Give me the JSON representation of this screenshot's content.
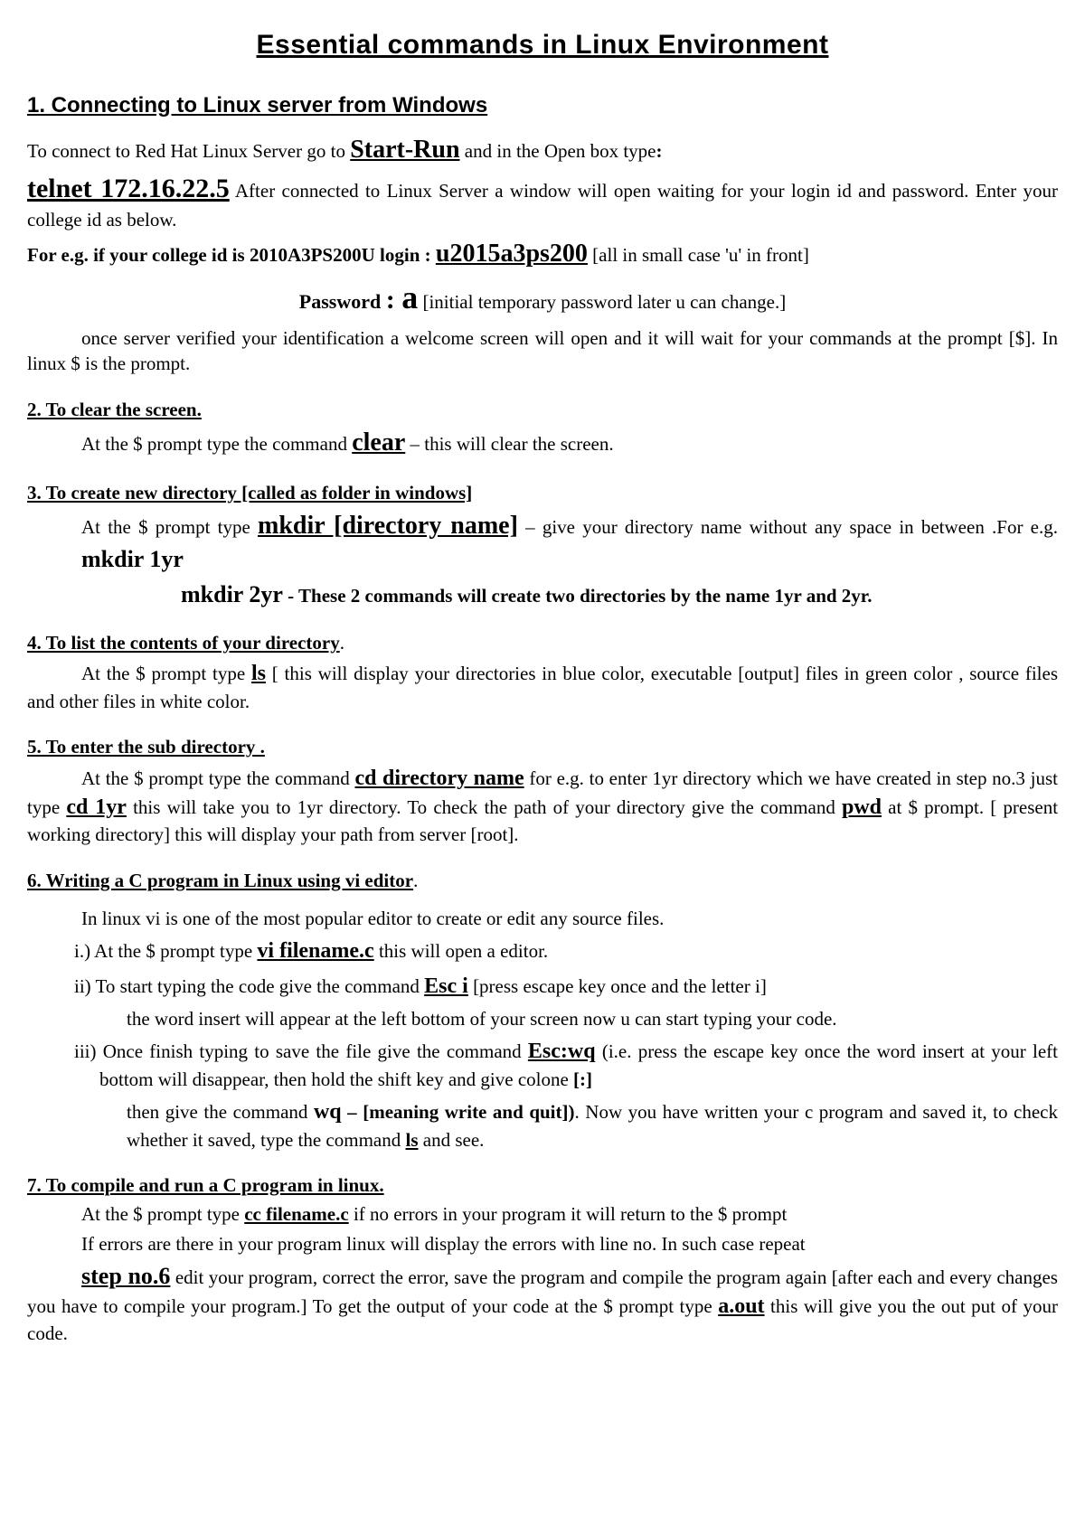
{
  "title": "Essential commands in  Linux Environment",
  "s1": {
    "heading": "1. Connecting to Linux server from Windows",
    "p1a": "To connect to Red Hat Linux Server go to ",
    "start_run": "Start-Run",
    "p1b": " and in the Open box type",
    "colon1": ":",
    "telnet": "telnet 172.16.22.5",
    "p2": "  After connected to Linux Server a window will open waiting for your login id and password. Enter your college id as below.",
    "p3a": "For e.g. if your college id is 2010A3PS200U login  : ",
    "login": "u2015a3ps200",
    "p3b": "  [all in small case 'u' in front]",
    "pwd_label": "Password ",
    "pwd_colon": ": ",
    "pwd_val": "a",
    "pwd_note": "  [initial temporary password later u can change.]",
    "p4": "once server verified your identification a welcome screen will open and it will wait for your commands at the prompt [$]. In linux $ is the prompt."
  },
  "s2": {
    "heading": "2. To clear the screen.",
    "p1a": "At the $ prompt type the command ",
    "cmd": "clear",
    "p1b": " – this will clear the screen."
  },
  "s3": {
    "heading": "3. To create new directory [called as folder in windows]",
    "p1a": "At the $ prompt type ",
    "cmd1": "mkdir [directory name]",
    "p1b": " – give your directory name without any space in between .For e.g. ",
    "cmd2": "mkdir 1yr",
    "cmd3": "mkdir 2yr",
    "p2": "  -  These 2 commands will create two directories by the name 1yr and 2yr."
  },
  "s4": {
    "heading": "4. To list the contents of your directory",
    "dot": ".",
    "p1a": "At the $ prompt type ",
    "cmd": "ls",
    "p1b": " [ this will display your directories in blue color, executable [output] files in green color , source files and other files in white color."
  },
  "s5": {
    "heading": "5. To enter the sub directory .",
    "p1a": "At the $ prompt type the command ",
    "cmd1": "cd directory name",
    "p1b": " for e.g. to enter 1yr directory which we have created in step no.3 just type ",
    "cmd2": "cd 1yr",
    "p1c": " this will take you to 1yr directory. To check the path of your directory give the command ",
    "cmd3": "pwd",
    "p1d": " at $ prompt. [ present working directory] this will display your path from server [root]."
  },
  "s6": {
    "heading": "6. Writing a C program in Linux using vi editor",
    "dot": ".",
    "intro": "In linux vi is one of the most popular editor to create or edit any source files.",
    "i_a": "i.) At the $ prompt type ",
    "vi": "vi filename.c",
    "i_b": " this will open a editor.",
    "ii_a": "ii) To start typing the code give the command ",
    "esc_i": "Esc i",
    "ii_b": " [press escape key once and the letter i]",
    "ii_c": "the word insert will appear at the left bottom of your screen now u can start typing your code.",
    "iii_a": "iii) Once finish typing to save the file give the command ",
    "esc_wq": "Esc:wq",
    "iii_b": " (i.e. press the escape key once the word insert at your left bottom will disappear, then hold the shift key and give colone ",
    "colon_br": "[:]",
    "iii_c": "then give the command ",
    "wq": "wq",
    "iii_d": " – [meaning write and quit])",
    "iii_e": ". Now you have written your c program and saved it, to check whether it saved, type the command ",
    "ls": "ls",
    "iii_f": " and see."
  },
  "s7": {
    "heading": "7. To compile and run a C program in linux.",
    "p1a": "At the $ prompt type ",
    "cc": "cc filename.c",
    "p1b": " if no errors in your program it will return to the $ prompt",
    "p2": "If errors are there in your program linux will display the errors with line no. In such case repeat",
    "step6": "step no.6",
    "p3a": " edit your program, correct the error, save the program and compile the program again [after each and every changes you have to compile your program.] To get the output of your code at the $ prompt type ",
    "aout": "a.out",
    "p3b": " this will give you the out put of your code."
  }
}
